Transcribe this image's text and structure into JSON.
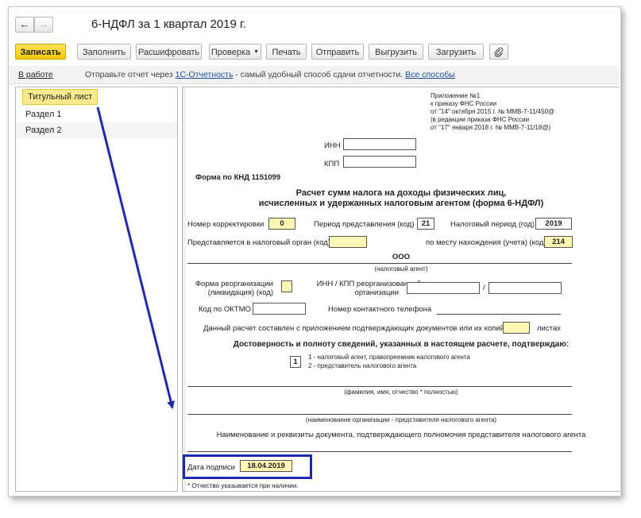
{
  "window": {
    "title": "6-НДФЛ за 1 квартал 2019 г.",
    "back_icon": "arrow-left",
    "forward_icon": "arrow-right"
  },
  "toolbar": {
    "save": "Записать",
    "fill": "Заполнить",
    "decode": "Расшифровать",
    "check": "Проверка",
    "print": "Печать",
    "send": "Отправить",
    "export": "Выгрузить",
    "import": "Загрузить",
    "attach_icon": "paperclip"
  },
  "infobar": {
    "status": "В работе",
    "text_before": "Отправьте отчет через",
    "service_link": "1С-Отчетность",
    "text_after": "- самый удобный способ сдачи отчетности.",
    "all_methods_link": "Все способы"
  },
  "sidebar": {
    "items": [
      {
        "label": "Титульный лист"
      },
      {
        "label": "Раздел 1"
      },
      {
        "label": "Раздел 2"
      }
    ]
  },
  "form": {
    "appendix": [
      "Приложение №1",
      "к приказу ФНС России",
      "от \"14\" октября 2015 г. № ММВ-7-11/450@",
      "(в редакции приказа ФНС России",
      "от \"17\" января 2018 г. № ММВ-7-11/18@)"
    ],
    "inn_label": "ИНН",
    "kpp_label": "КПП",
    "knd": "Форма по КНД 1151099",
    "heading_1": "Расчет сумм налога на доходы физических лиц,",
    "heading_2": "исчисленных и удержанных налоговым агентом (форма 6-НДФЛ)",
    "correction_label": "Номер корректировки",
    "correction_value": "0",
    "period_label": "Период представления (код)",
    "period_value": "21",
    "tax_period_label": "Налоговый период (год)",
    "tax_period_value": "2019",
    "authority_label": "Представляется в налоговый орган (код)",
    "location_label": "по месту нахождения (учета) (код)",
    "location_value": "214",
    "agent_name": "ООО",
    "agent_caption": "(налоговый агент)",
    "reorg_form_label_1": "Форма реорганизации",
    "reorg_form_label_2": "(ликвидация) (код)",
    "reorg_inn_label_1": "ИНН / КПП реорганизованной",
    "reorg_inn_label_2": "организации",
    "slash": "/",
    "oktmo_label": "Код по ОКТМО",
    "phone_label": "Номер контактного телефона",
    "pages_label": "Данный расчет составлен с приложением подтверждающих документов или их копий на",
    "pages_suffix": "листах",
    "confirm_heading": "Достоверность и полноту сведений, указанных в настоящем расчете, подтверждаю:",
    "signer_code": "1",
    "signer_option_1": "1 - налоговый агент, правопреемник налогового агента",
    "signer_option_2": "2 - представитель налогового агента",
    "fio_caption": "(фамилия, имя, отчество * полностью)",
    "org_caption": "(наименование организации - представителя налогового агента)",
    "doc_caption": "Наименование и реквизиты документа, подтверждающего полномочия представителя налогового агента",
    "sign_date_label": "Дата подписи",
    "sign_date_value": "18.04.2019",
    "footnote": "* Отчество указывается при наличии."
  },
  "colors": {
    "accent_yellow": "#f5c900",
    "highlight_blue": "#1f2aa8",
    "link_blue": "#1b4f9b",
    "field_yellow": "#fff7b3"
  }
}
